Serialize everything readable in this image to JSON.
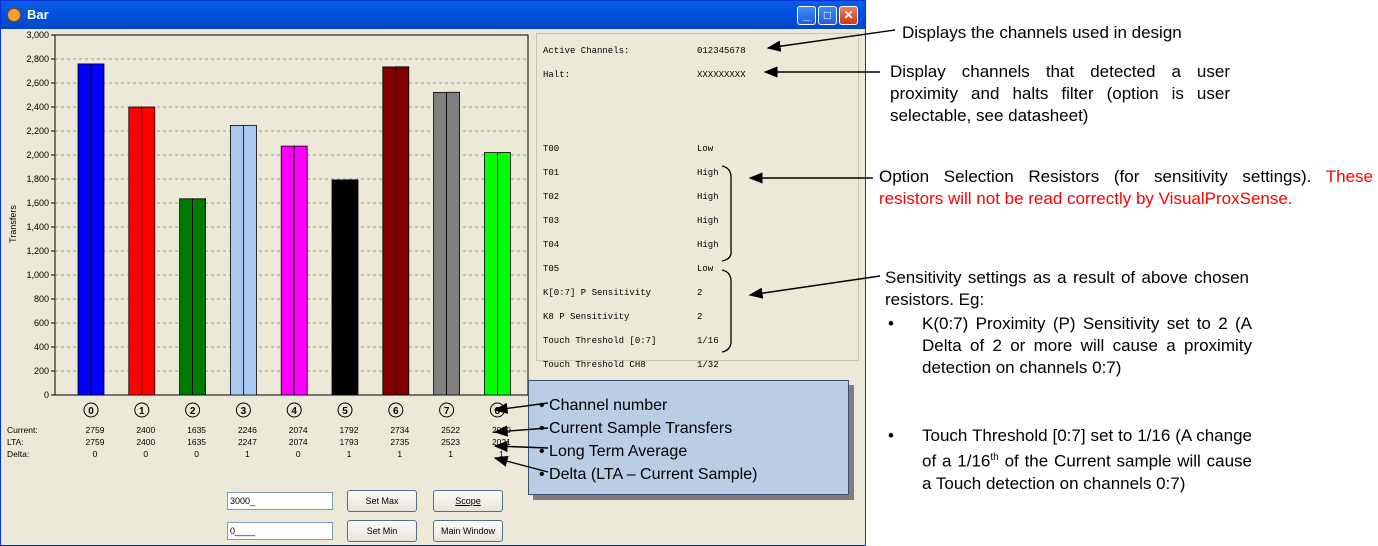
{
  "window": {
    "title": "Bar",
    "minimize": "_",
    "maximize": "□",
    "close": "✕",
    "icon": "app-icon"
  },
  "chart_data": {
    "type": "bar",
    "ylabel": "Transfers",
    "ylim": [
      0,
      3000
    ],
    "yticks": [
      "0",
      "200",
      "400",
      "600",
      "800",
      "1,000",
      "1,200",
      "1,400",
      "1,600",
      "1,800",
      "2,000",
      "2,200",
      "2,400",
      "2,600",
      "2,800",
      "3,000"
    ],
    "categories": [
      "0",
      "1",
      "2",
      "3",
      "4",
      "5",
      "6",
      "7",
      "8"
    ],
    "series": [
      {
        "values": [
          2759,
          2400,
          1635,
          2246,
          2074,
          1792,
          2734,
          2522,
          2020
        ]
      },
      {
        "values": [
          2759,
          2400,
          1635,
          2247,
          2074,
          1793,
          2735,
          2523,
          2021
        ]
      }
    ],
    "colors": [
      "#0000ff",
      "#ff0000",
      "#007a00",
      "#a9c8f0",
      "#ff00ff",
      "#000000",
      "#800000",
      "#808080",
      "#00ff00"
    ],
    "grid": true
  },
  "stats": {
    "current_label": "Current:",
    "lta_label": "LTA:",
    "delta_label": "Delta:",
    "current": [
      "2759",
      "2400",
      "1635",
      "2246",
      "2074",
      "1792",
      "2734",
      "2522",
      "2020"
    ],
    "lta": [
      "2759",
      "2400",
      "1635",
      "2247",
      "2074",
      "1793",
      "2735",
      "2523",
      "2021"
    ],
    "delta": [
      "0",
      "0",
      "0",
      "1",
      "0",
      "1",
      "1",
      "1",
      "1"
    ]
  },
  "panel": {
    "active_label": "Active Channels:",
    "active_value": "012345678",
    "halt_label": "Halt:",
    "halt_value": "XXXXXXXXX",
    "resistors": [
      {
        "label": "T00",
        "value": "Low"
      },
      {
        "label": "T01",
        "value": "High"
      },
      {
        "label": "T02",
        "value": "High"
      },
      {
        "label": "T03",
        "value": "High"
      },
      {
        "label": "T04",
        "value": "High"
      },
      {
        "label": "T05",
        "value": "Low"
      }
    ],
    "settings": [
      {
        "label": "K[0:7] P Sensitivity",
        "value": "2"
      },
      {
        "label": "K8 P Sensitivity",
        "value": "2"
      },
      {
        "label": "Touch Threshold [0:7]",
        "value": "1/16"
      },
      {
        "label": "Touch Threshold CH8",
        "value": "1/32"
      }
    ]
  },
  "controls": {
    "max_input": "3000_",
    "min_input": "0____",
    "set_max": "Set Max",
    "set_min": "Set Min",
    "scope": "Scope",
    "main_window": "Main Window"
  },
  "annotations": {
    "channels_used": "Displays the channels used in design",
    "halt_desc": "Display channels that detected a user proximity and halts filter (option is user selectable, see datasheet)",
    "option_desc": "Option Selection Resistors (for sensitivity settings).",
    "option_warning": "These resistors will not be read correctly by VisualProxSense.",
    "sens_desc": "Sensitivity settings as a result of above chosen resistors. Eg:",
    "bullet1": "K(0:7) Proximity (P) Sensitivity set to 2 (A Delta of 2 or more will cause a proximity detection on channels 0:7)",
    "bullet2_pre": "Touch Threshold [0:7] set to 1/16 (A change of a 1/16",
    "bullet2_sup": "th",
    "bullet2_post": " of the Current sample will cause a Touch detection on channels 0:7)",
    "box_items": [
      "Channel number",
      "Current Sample Transfers",
      "Long Term Average",
      "Delta (LTA – Current Sample)"
    ]
  }
}
